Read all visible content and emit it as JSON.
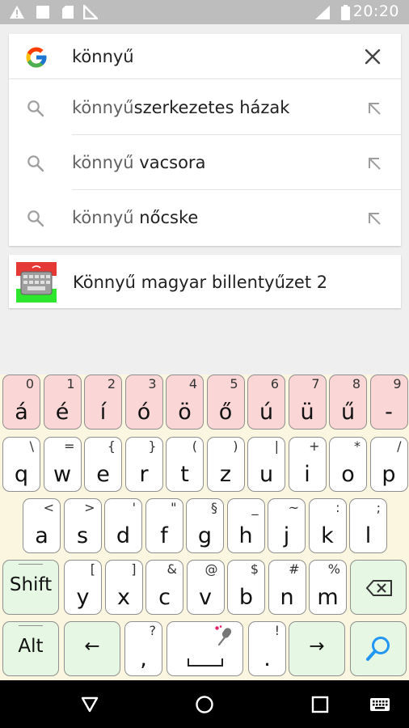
{
  "status_bar": {
    "time": "20:20",
    "icons": [
      "warning-icon",
      "square-icon",
      "sd-card-icon",
      "no-sim-icon",
      "signal-icon",
      "battery-icon"
    ]
  },
  "search": {
    "query": "könnyű",
    "suggestions": [
      {
        "prefix": "könnyű",
        "rest": "szerkezetes házak"
      },
      {
        "prefix": "könnyű",
        "rest": " vacsora"
      },
      {
        "prefix": "könnyű",
        "rest": " nőcske"
      }
    ]
  },
  "app_result": {
    "name": "Könnyű magyar billentyűzet 2",
    "icon": "keyboard-app-icon"
  },
  "keyboard": {
    "row1": [
      {
        "main": "á",
        "alt": "0"
      },
      {
        "main": "é",
        "alt": "1"
      },
      {
        "main": "í",
        "alt": "2"
      },
      {
        "main": "ó",
        "alt": "3"
      },
      {
        "main": "ö",
        "alt": "4"
      },
      {
        "main": "ő",
        "alt": "5"
      },
      {
        "main": "ú",
        "alt": "6"
      },
      {
        "main": "ü",
        "alt": "7"
      },
      {
        "main": "ű",
        "alt": "8"
      },
      {
        "main": "-",
        "alt": "9"
      }
    ],
    "row2": [
      {
        "main": "q",
        "alt": "\\"
      },
      {
        "main": "w",
        "alt": "="
      },
      {
        "main": "e",
        "alt": "{"
      },
      {
        "main": "r",
        "alt": "}"
      },
      {
        "main": "t",
        "alt": "("
      },
      {
        "main": "z",
        "alt": ")"
      },
      {
        "main": "u",
        "alt": "|"
      },
      {
        "main": "i",
        "alt": "+"
      },
      {
        "main": "o",
        "alt": "*"
      },
      {
        "main": "p",
        "alt": "/"
      }
    ],
    "row3": [
      {
        "main": "a",
        "alt": "<"
      },
      {
        "main": "s",
        "alt": ">"
      },
      {
        "main": "d",
        "alt": "'"
      },
      {
        "main": "f",
        "alt": "\""
      },
      {
        "main": "g",
        "alt": "§"
      },
      {
        "main": "h",
        "alt": "_"
      },
      {
        "main": "j",
        "alt": "~"
      },
      {
        "main": "k",
        "alt": ":"
      },
      {
        "main": "l",
        "alt": ";"
      }
    ],
    "row4": [
      {
        "main": "y",
        "alt": "["
      },
      {
        "main": "x",
        "alt": "]"
      },
      {
        "main": "c",
        "alt": "&"
      },
      {
        "main": "v",
        "alt": "@"
      },
      {
        "main": "b",
        "alt": "$"
      },
      {
        "main": "n",
        "alt": "#"
      },
      {
        "main": "m",
        "alt": "%"
      }
    ],
    "shift_label": "Shift",
    "alt_label": "Alt",
    "comma": {
      "main": ",",
      "alt": "?"
    },
    "period": {
      "main": ".",
      "alt": "!"
    },
    "left_arrow": "←",
    "right_arrow": "→"
  },
  "navbar": {
    "icons": [
      "back-icon",
      "home-icon",
      "recents-icon",
      "keyboard-switch-icon"
    ]
  },
  "colors": {
    "number_row": "#fbd6d6",
    "letter_key": "#ffffff",
    "modifier_key": "#e6f8e4",
    "keyboard_bg": "#fbf6e0",
    "mic": "#e91e63",
    "search_key_icon": "#2196f3"
  }
}
